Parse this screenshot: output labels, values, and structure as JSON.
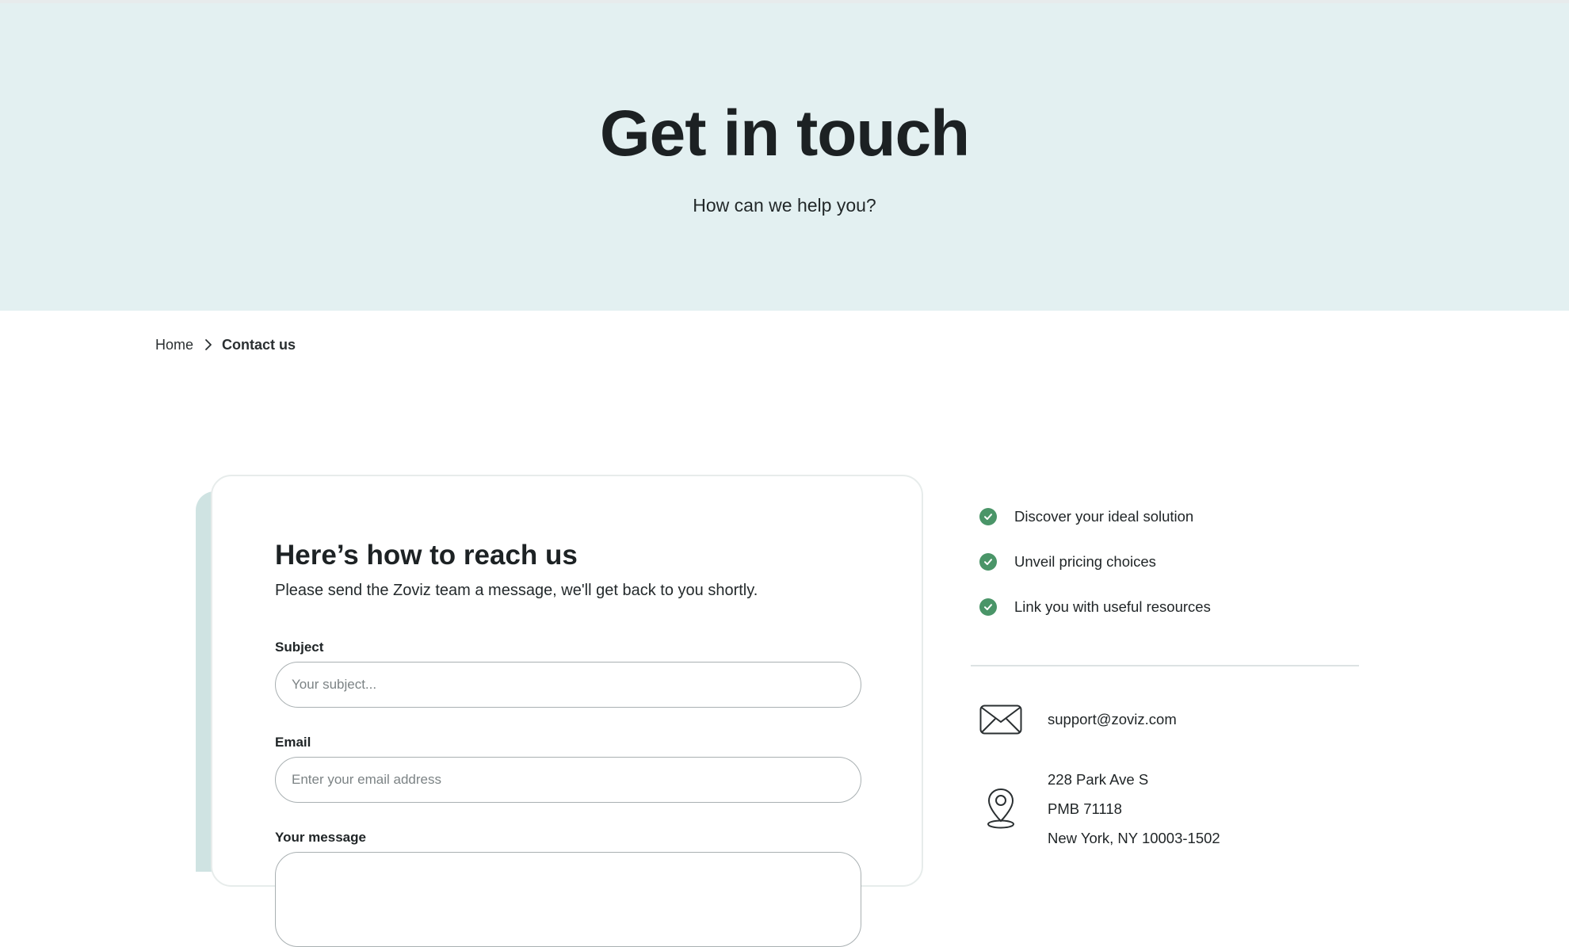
{
  "hero": {
    "title": "Get in touch",
    "subtitle": "How can we help you?",
    "background_color": "#e3f0f1"
  },
  "breadcrumb": {
    "home": "Home",
    "current": "Contact us"
  },
  "form_card": {
    "heading": "Here’s how to reach us",
    "intro": "Please send the Zoviz team a message, we'll get back to you shortly.",
    "fields": {
      "subject": {
        "label": "Subject",
        "placeholder": "Your subject...",
        "value": ""
      },
      "email": {
        "label": "Email",
        "placeholder": "Enter your email address",
        "value": ""
      },
      "message": {
        "label": "Your message",
        "value": ""
      }
    },
    "accent_color": "#cfe3e2"
  },
  "benefits": {
    "items": [
      {
        "label": "Discover your ideal solution",
        "icon": "check-circle-icon"
      },
      {
        "label": "Unveil pricing choices",
        "icon": "check-circle-icon"
      },
      {
        "label": "Link you with useful resources",
        "icon": "check-circle-icon"
      }
    ],
    "check_color": "#4a9568"
  },
  "contact": {
    "email": {
      "icon": "envelope-icon",
      "value": "support@zoviz.com"
    },
    "address": {
      "icon": "map-pin-icon",
      "lines": [
        "228 Park Ave S",
        "PMB 71118",
        "New York, NY 10003-1502"
      ]
    }
  }
}
